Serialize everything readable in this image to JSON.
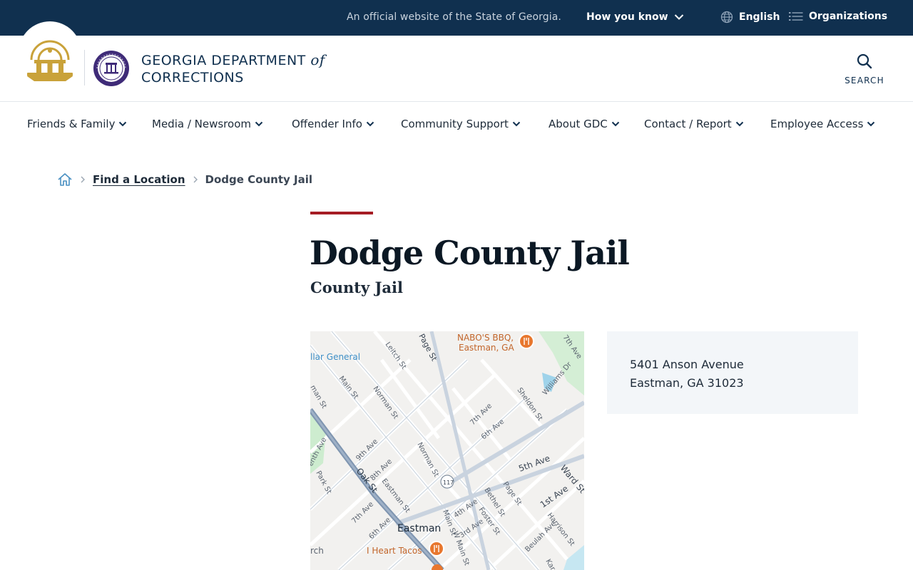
{
  "topbar": {
    "official_text": "An official website of the State of Georgia.",
    "how_you_know": "How you know",
    "language": "English",
    "organizations": "Organizations"
  },
  "header": {
    "dept_line1": "GEORGIA DEPARTMENT",
    "dept_of": "of",
    "dept_line2": "CORRECTIONS",
    "search_label": "SEARCH"
  },
  "nav": {
    "items": [
      "Friends & Family",
      "Media / Newsroom",
      "Offender Info",
      "Community Support",
      "About GDC",
      "Contact / Report",
      "Employee Access"
    ]
  },
  "breadcrumb": {
    "link": "Find a Location",
    "current": "Dodge County Jail"
  },
  "page": {
    "title": "Dodge County Jail",
    "subtitle": "County Jail"
  },
  "address": {
    "line1": "5401 Anson Avenue",
    "line2": "Eastman, GA 31023"
  },
  "map": {
    "labels": {
      "nabos": "NABO'S BBQ,",
      "nabos_city": "Eastman, GA",
      "hospital": "llar General",
      "leitch": "Leitch St",
      "page_top": "Page St",
      "seventh_ne": "7th Ave",
      "williams": "Williams Dr",
      "sheldon": "Sheldon St",
      "main_nw": "Main St",
      "norman_top": "Norman St",
      "norman_mid": "Norman St",
      "man_st": "man St",
      "seventh_mid": "7th Ave",
      "sixth_mid": "6th Ave",
      "fifth": "5th Ave",
      "ward": "Ward St",
      "first": "1st Ave",
      "enth": "enth Ave",
      "park": "Park St",
      "oak": "Oak St",
      "ninth": "9th Ave",
      "eighth": "8th Ave",
      "eastman_st": "Eastman St",
      "route": "117",
      "bethel": "Bethel St",
      "page_low": "Page St",
      "seventh_low": "7th Ave",
      "sixth_low": "6th Ave",
      "fourth": "4th Ave",
      "foster": "Foster St",
      "third": "3rd Ave",
      "main_low": "Main St",
      "w_main": "W Main St",
      "harrison": "Harrison St",
      "beulah": "Beulah Ave",
      "town": "Eastman",
      "tacos": "I Heart Tacos",
      "rch": "rch",
      "kar": "Kar"
    }
  },
  "colors": {
    "topbar": "#10304f",
    "accent_red": "#a51c24",
    "seal_gold": "#c9a23a",
    "map_poi": "#e8772e"
  }
}
